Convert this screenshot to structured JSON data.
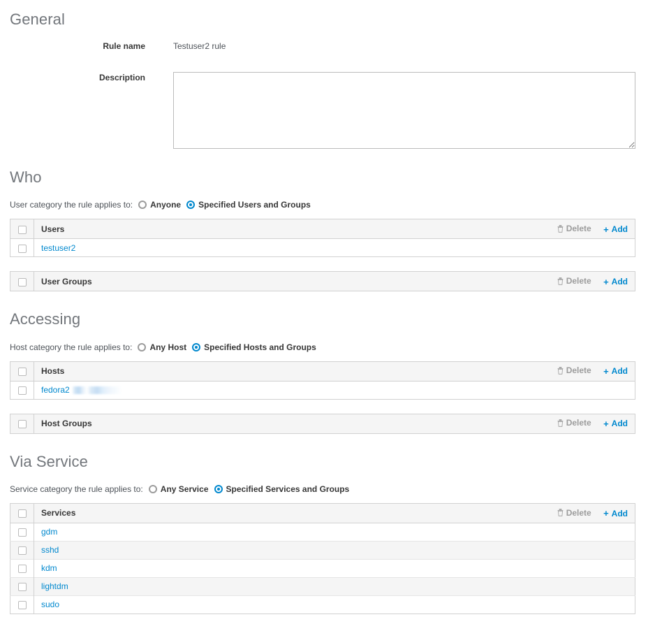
{
  "colors": {
    "accent": "#0088ce",
    "heading": "#72767b",
    "text": "#4d5258",
    "label": "#363636",
    "muted": "#9c9c9c",
    "border": "#d1d1d1",
    "header_bg": "#f5f5f5",
    "stripe_bg": "#f5f5f5"
  },
  "icons": {
    "trash": "trash-icon",
    "plus": "plus-icon",
    "radio_on": "radio-selected-icon",
    "radio_off": "radio-unselected-icon",
    "checkbox": "checkbox-icon",
    "resize_grip": "resize-grip-icon"
  },
  "actions": {
    "delete_label": "Delete",
    "add_label": "Add",
    "plus_glyph": "+"
  },
  "general": {
    "title": "General",
    "rule_name": {
      "label": "Rule name",
      "value": "Testuser2 rule"
    },
    "description": {
      "label": "Description",
      "value": "",
      "placeholder": ""
    }
  },
  "who": {
    "title": "Who",
    "category": {
      "prompt": "User category the rule applies to:",
      "options": [
        {
          "label": "Anyone",
          "selected": false
        },
        {
          "label": "Specified Users and Groups",
          "selected": true
        }
      ]
    },
    "users_table": {
      "header": "Users",
      "rows": [
        {
          "name": "testuser2",
          "redacted": false
        }
      ]
    },
    "user_groups_table": {
      "header": "User Groups",
      "rows": []
    }
  },
  "accessing": {
    "title": "Accessing",
    "category": {
      "prompt": "Host category the rule applies to:",
      "options": [
        {
          "label": "Any Host",
          "selected": false
        },
        {
          "label": "Specified Hosts and Groups",
          "selected": true
        }
      ]
    },
    "hosts_table": {
      "header": "Hosts",
      "rows": [
        {
          "name": "fedora2",
          "redacted": true
        }
      ]
    },
    "host_groups_table": {
      "header": "Host Groups",
      "rows": []
    }
  },
  "via_service": {
    "title": "Via Service",
    "category": {
      "prompt": "Service category the rule applies to:",
      "options": [
        {
          "label": "Any Service",
          "selected": false
        },
        {
          "label": "Specified Services and Groups",
          "selected": true
        }
      ]
    },
    "services_table": {
      "header": "Services",
      "rows": [
        {
          "name": "gdm",
          "redacted": false
        },
        {
          "name": "sshd",
          "redacted": false
        },
        {
          "name": "kdm",
          "redacted": false
        },
        {
          "name": "lightdm",
          "redacted": false
        },
        {
          "name": "sudo",
          "redacted": false
        }
      ]
    }
  }
}
